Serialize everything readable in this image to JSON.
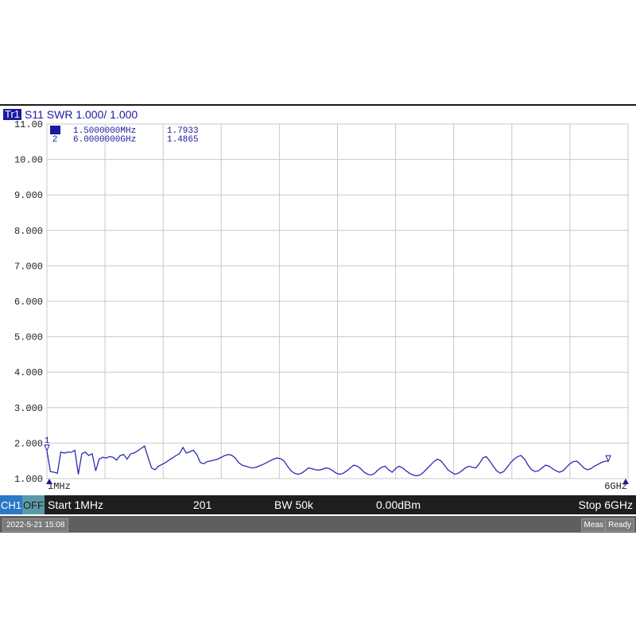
{
  "header": {
    "trace_badge": "Tr1",
    "title": "S11 SWR 1.000/ 1.000"
  },
  "markers": [
    {
      "num": "1",
      "freq": "1.5000000MHz",
      "value": "1.7933",
      "active": true
    },
    {
      "num": "2",
      "freq": "6.0000000GHz",
      "value": "1.4865",
      "active": false
    }
  ],
  "chart_data": {
    "type": "line",
    "ylim": [
      1.0,
      11.0
    ],
    "y_ticks": [
      "11.00",
      "10.00",
      "9.000",
      "8.000",
      "7.000",
      "6.000",
      "5.000",
      "4.000",
      "3.000",
      "2.000",
      "1.000"
    ],
    "x_start_label": "1MHz",
    "x_end_label": "6GHz",
    "grid": true,
    "series": [
      {
        "color": "#2b2bb0",
        "x_frac": [
          0,
          0.006,
          0.012,
          0.018,
          0.024,
          0.03,
          0.036,
          0.042,
          0.048,
          0.054,
          0.06,
          0.066,
          0.072,
          0.078,
          0.084,
          0.09,
          0.096,
          0.102,
          0.108,
          0.114,
          0.12,
          0.126,
          0.132,
          0.138,
          0.144,
          0.15,
          0.156,
          0.162,
          0.168,
          0.174,
          0.18,
          0.186,
          0.192,
          0.198,
          0.204,
          0.21,
          0.216,
          0.222,
          0.228,
          0.234,
          0.24,
          0.246,
          0.252,
          0.258,
          0.264,
          0.27,
          0.276,
          0.282,
          0.288,
          0.294,
          0.3,
          0.306,
          0.312,
          0.318,
          0.324,
          0.33,
          0.336,
          0.342,
          0.348,
          0.354,
          0.36,
          0.366,
          0.372,
          0.378,
          0.384,
          0.39,
          0.396,
          0.402,
          0.408,
          0.414,
          0.42,
          0.426,
          0.432,
          0.438,
          0.444,
          0.45,
          0.456,
          0.462,
          0.468,
          0.474,
          0.48,
          0.486,
          0.492,
          0.498,
          0.504,
          0.51,
          0.516,
          0.522,
          0.528,
          0.534,
          0.54,
          0.546,
          0.552,
          0.558,
          0.564,
          0.57,
          0.576,
          0.582,
          0.588,
          0.594,
          0.6,
          0.606,
          0.612,
          0.618,
          0.624,
          0.63,
          0.636,
          0.642,
          0.648,
          0.654,
          0.66,
          0.666,
          0.672,
          0.678,
          0.684,
          0.69,
          0.696,
          0.702,
          0.708,
          0.714,
          0.72,
          0.726,
          0.732,
          0.738,
          0.744,
          0.75,
          0.756,
          0.762,
          0.768,
          0.774,
          0.78,
          0.786,
          0.792,
          0.798,
          0.804,
          0.81,
          0.816,
          0.822,
          0.828,
          0.834,
          0.84,
          0.846,
          0.852,
          0.858,
          0.864,
          0.87,
          0.876,
          0.882,
          0.888,
          0.894,
          0.9,
          0.906,
          0.912,
          0.918,
          0.924,
          0.93,
          0.936,
          0.942,
          0.948,
          0.954,
          0.96,
          0.966,
          0.972,
          0.978,
          0.984,
          0.99,
          0.996,
          1.0
        ],
        "y": [
          1.79,
          1.2,
          1.18,
          1.15,
          1.75,
          1.72,
          1.75,
          1.74,
          1.8,
          1.12,
          1.7,
          1.75,
          1.65,
          1.7,
          1.22,
          1.55,
          1.6,
          1.58,
          1.62,
          1.6,
          1.52,
          1.65,
          1.68,
          1.55,
          1.7,
          1.72,
          1.78,
          1.85,
          1.92,
          1.6,
          1.3,
          1.25,
          1.35,
          1.4,
          1.45,
          1.52,
          1.58,
          1.65,
          1.7,
          1.88,
          1.72,
          1.76,
          1.8,
          1.68,
          1.45,
          1.42,
          1.48,
          1.5,
          1.52,
          1.55,
          1.6,
          1.65,
          1.68,
          1.66,
          1.58,
          1.45,
          1.38,
          1.35,
          1.32,
          1.3,
          1.32,
          1.36,
          1.4,
          1.45,
          1.5,
          1.55,
          1.58,
          1.56,
          1.5,
          1.35,
          1.22,
          1.15,
          1.12,
          1.15,
          1.22,
          1.3,
          1.28,
          1.25,
          1.24,
          1.26,
          1.3,
          1.28,
          1.22,
          1.15,
          1.12,
          1.15,
          1.22,
          1.3,
          1.38,
          1.35,
          1.28,
          1.18,
          1.12,
          1.1,
          1.15,
          1.25,
          1.32,
          1.35,
          1.25,
          1.18,
          1.28,
          1.35,
          1.3,
          1.22,
          1.15,
          1.1,
          1.08,
          1.1,
          1.18,
          1.28,
          1.38,
          1.48,
          1.55,
          1.5,
          1.38,
          1.25,
          1.18,
          1.12,
          1.15,
          1.22,
          1.3,
          1.35,
          1.32,
          1.3,
          1.42,
          1.58,
          1.62,
          1.5,
          1.35,
          1.22,
          1.15,
          1.2,
          1.32,
          1.45,
          1.55,
          1.62,
          1.65,
          1.55,
          1.38,
          1.25,
          1.2,
          1.22,
          1.3,
          1.38,
          1.35,
          1.28,
          1.22,
          1.18,
          1.22,
          1.32,
          1.42,
          1.48,
          1.49,
          1.4,
          1.3,
          1.25,
          1.28,
          1.35,
          1.4,
          1.45,
          1.49,
          1.49
        ]
      }
    ]
  },
  "bar1": {
    "ch": "CH1",
    "off": "OFF",
    "start": "Start 1MHz",
    "points": "201",
    "bw": "BW 50k",
    "power": "0.00dBm",
    "stop": "Stop 6GHz"
  },
  "bar2": {
    "datetime": "2022-5-21 15:08",
    "meas": "Meas",
    "ready": "Ready"
  },
  "colors": {
    "trace": "#2b2bb0",
    "grid": "#c8c8c8",
    "marker_blue": "#1a1aa0"
  }
}
